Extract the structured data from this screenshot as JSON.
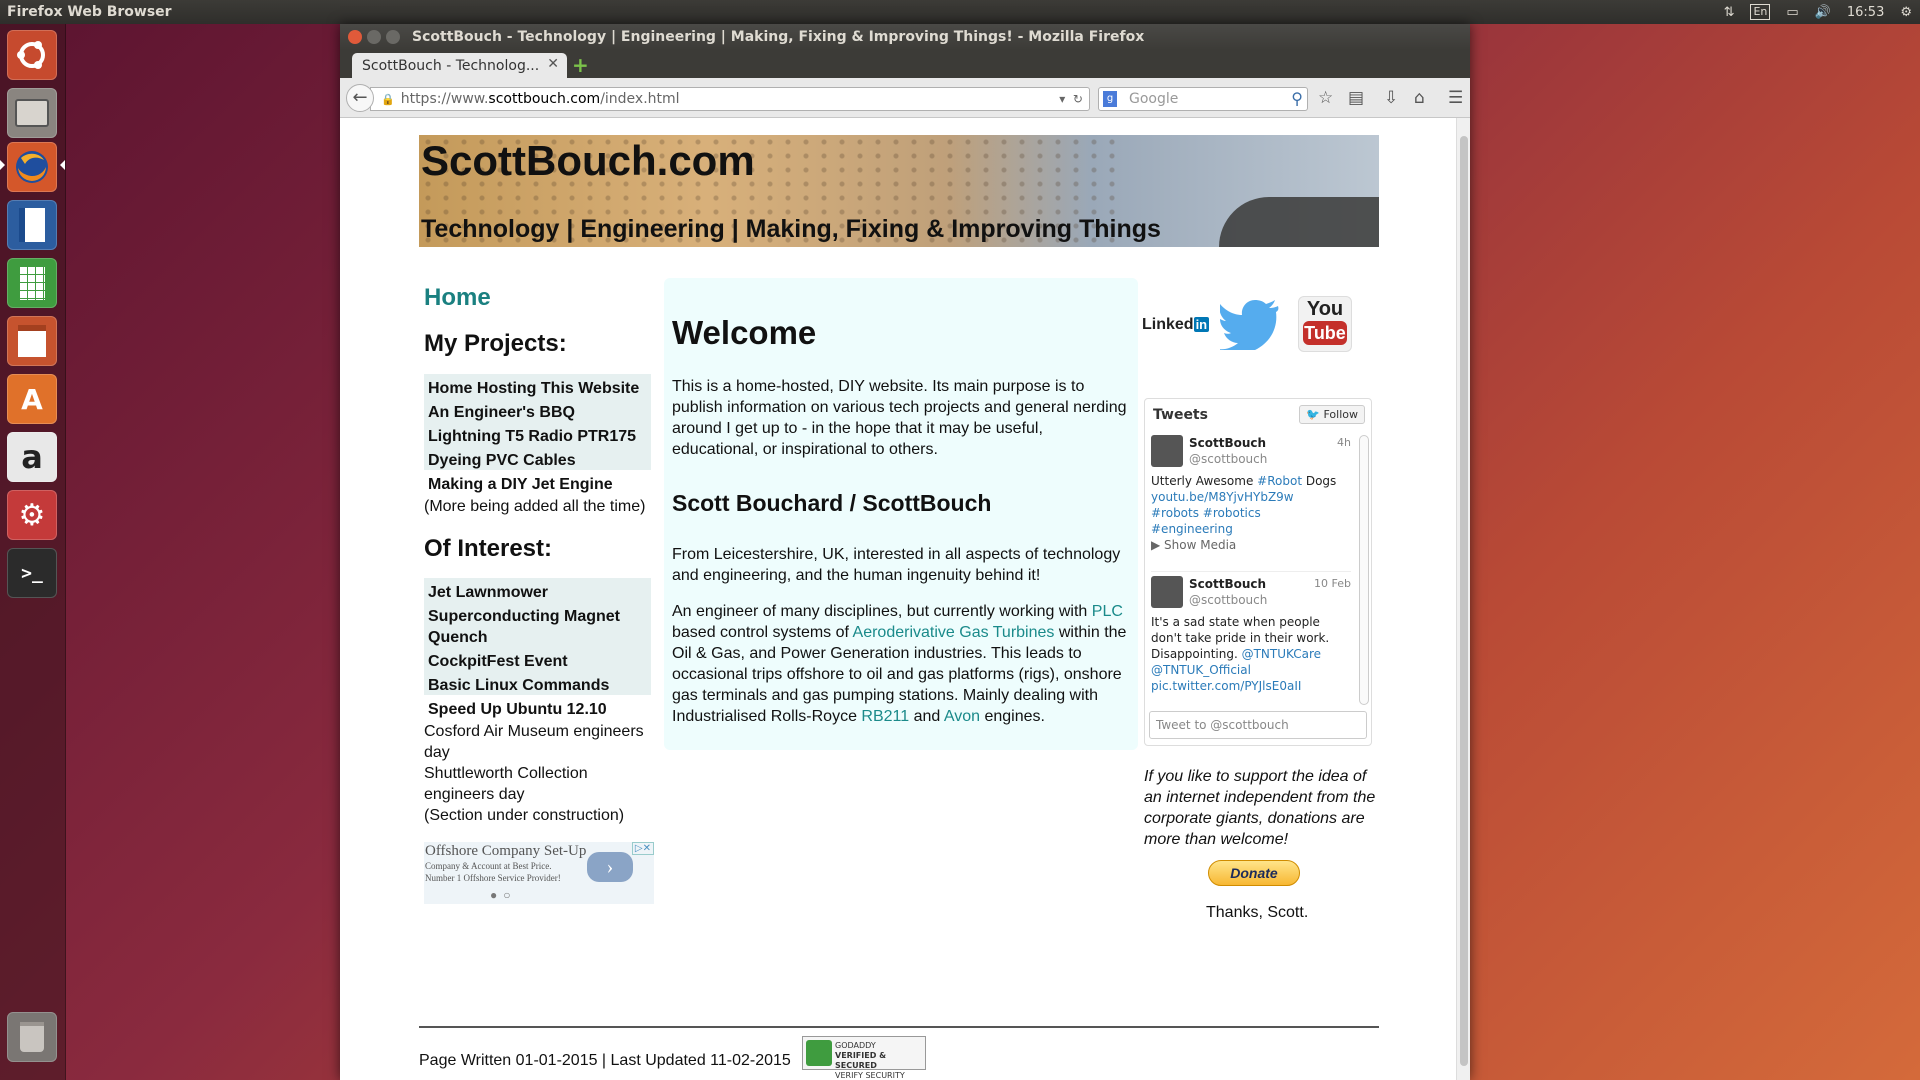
{
  "top_panel": {
    "app_title": "Firefox Web Browser",
    "keyboard": "En",
    "time": "16:53"
  },
  "launcher": {
    "items": [
      "ubuntu-dash",
      "files",
      "firefox",
      "writer",
      "calc",
      "impress",
      "software-center",
      "amazon",
      "system-settings",
      "terminal",
      "trash"
    ]
  },
  "browser": {
    "window_title": "ScottBouch - Technology | Engineering | Making, Fixing & Improving Things! - Mozilla Firefox",
    "tab_title": "ScottBouch - Technolog...",
    "url_prefix": "https://www.",
    "url_host": "scottbouch.com",
    "url_path": "/index.html",
    "search_placeholder": "Google"
  },
  "banner": {
    "title": "ScottBouch.com",
    "tagline": "Technology | Engineering | Making, Fixing & Improving Things"
  },
  "left": {
    "home": "Home",
    "projects_heading": "My Projects:",
    "projects": [
      "Home Hosting This Website",
      "An Engineer's BBQ",
      "Lightning T5 Radio PTR175",
      "Dyeing PVC Cables",
      "Making a DIY Jet Engine"
    ],
    "projects_note": "(More being added all the time)",
    "interest_heading": "Of Interest:",
    "interest": [
      "Jet Lawnmower",
      "Superconducting Magnet Quench",
      "CockpitFest Event",
      "Basic Linux Commands",
      "Speed Up Ubuntu 12.10"
    ],
    "interest_plain_1": "Cosford Air Museum engineers day",
    "interest_plain_2": "Shuttleworth Collection engineers day",
    "interest_note": "(Section under construction)"
  },
  "ad": {
    "title": "Offshore Company Set-Up",
    "line1": "Company & Account at Best Price.",
    "line2": "Number 1 Offshore Service Provider!"
  },
  "center": {
    "welcome": "Welcome",
    "intro": "This is a home-hosted, DIY website. Its main purpose is to publish information on various tech projects and general nerding around I get up to - in the hope that it may be useful, educational, or inspirational to others.",
    "name_heading": "Scott Bouchard / ScottBouch",
    "from": "From Leicestershire, UK, interested in all aspects of technology and engineering, and the human ingenuity behind it!",
    "eng_1": "An engineer of many disciplines, but currently working with ",
    "eng_plc": "PLC",
    "eng_2": " based control systems of ",
    "eng_turbines": "Aeroderivative Gas Turbines",
    "eng_3": " within the Oil & Gas, and Power Generation industries. This leads to occasional trips offshore to oil and gas platforms (rigs), onshore gas terminals and gas pumping stations. Mainly dealing with Industrialised Rolls-Royce ",
    "eng_rb211": "RB211",
    "eng_4": " and ",
    "eng_avon": "Avon",
    "eng_5": " engines."
  },
  "right": {
    "linkedin": "Linked",
    "linkedin_in": "in",
    "youtube_top": "You",
    "youtube_bottom": "Tube",
    "tweets_heading": "Tweets",
    "follow": "Follow",
    "tweet1": {
      "name": "ScottBouch",
      "handle": "@scottbouch",
      "time": "4h",
      "text": "Utterly Awesome ",
      "tag": "#Robot",
      "text2": " Dogs",
      "link": "youtu.be/M8YjvHYbZ9w",
      "tags2": "#robots #robotics",
      "tags3": "#engineering",
      "media": "Show Media"
    },
    "tweet2": {
      "name": "ScottBouch",
      "handle": "@scottbouch",
      "time": "10 Feb",
      "text": "It's a sad state when people don't take pride in their work. Disappointing. ",
      "mention1": "@TNTUKCare",
      "mention2": "@TNTUK_Official",
      "link": "pic.twitter.com/PYJlsE0aII"
    },
    "tweet_placeholder": "Tweet to @scottbouch",
    "donate_text": "If you like to support the idea of an internet independent from the corporate giants, donations are more than welcome!",
    "donate_button": "Donate",
    "thanks": "Thanks, Scott."
  },
  "footer": {
    "text": "Page Written 01-01-2015 | Last Updated 11-02-2015",
    "badge_line1": "GODADDY",
    "badge_line2": "VERIFIED & SECURED",
    "badge_line3": "VERIFY SECURITY"
  }
}
